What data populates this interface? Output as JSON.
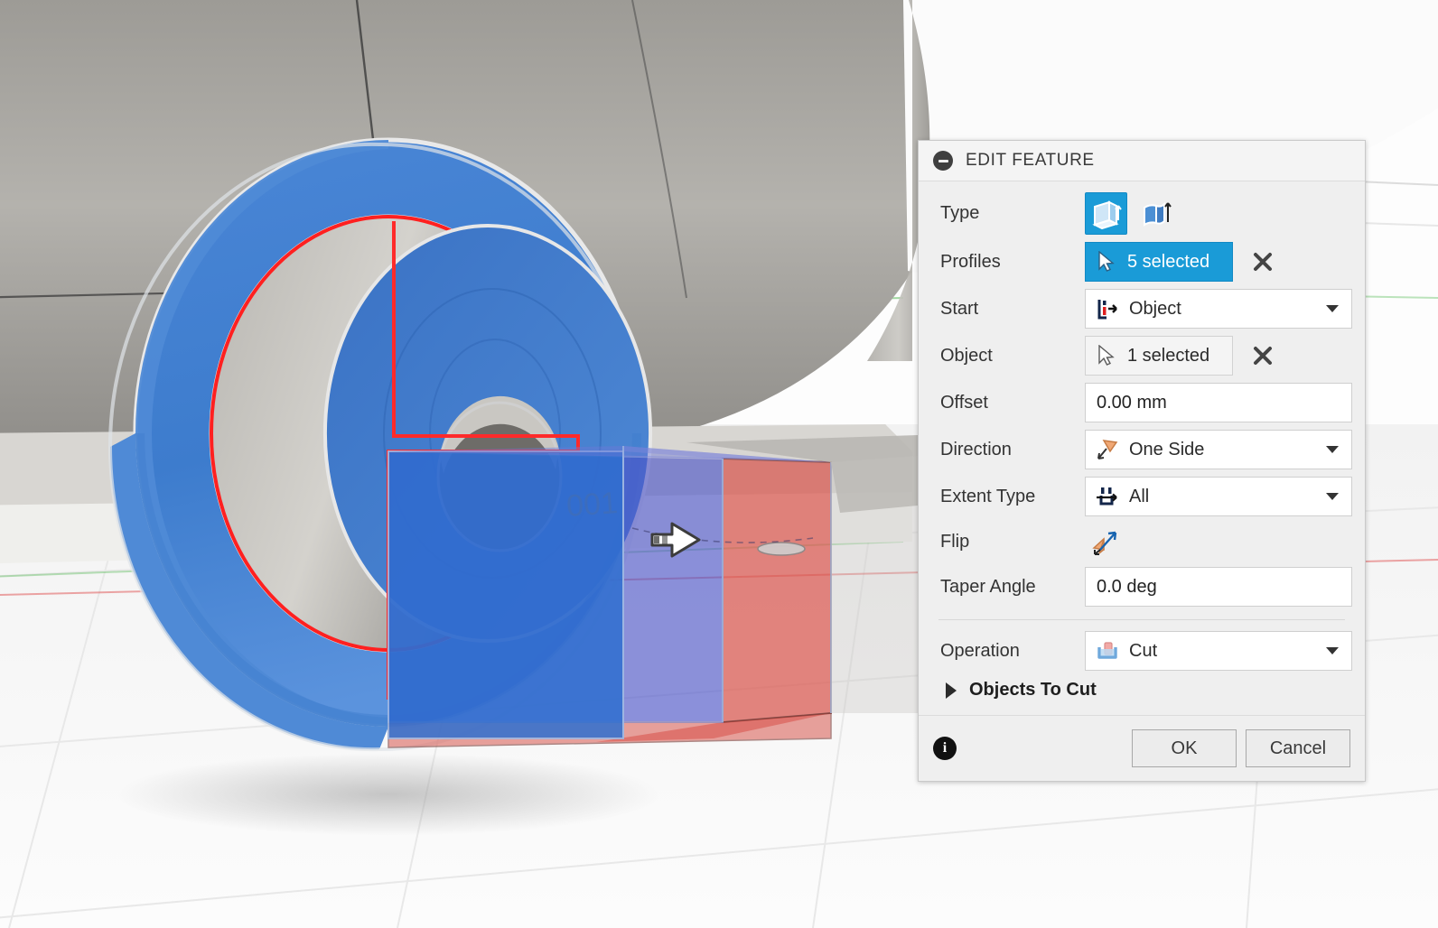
{
  "dialog": {
    "title": "EDIT FEATURE",
    "collapse_icon": "minus-circle-icon",
    "rows": {
      "type": {
        "label": "Type",
        "options": [
          "extrude-profile-icon",
          "extrude-surface-icon"
        ],
        "selected_index": 0
      },
      "profiles": {
        "label": "Profiles",
        "value": "5 selected",
        "selected": true,
        "clear_icon": "close-icon"
      },
      "start": {
        "label": "Start",
        "value": "Object",
        "icon": "start-object-icon"
      },
      "object": {
        "label": "Object",
        "value": "1 selected",
        "selected": false,
        "clear_icon": "close-icon"
      },
      "offset": {
        "label": "Offset",
        "value": "0.00 mm"
      },
      "direction": {
        "label": "Direction",
        "value": "One Side",
        "icon": "one-side-icon"
      },
      "extent_type": {
        "label": "Extent Type",
        "value": "All",
        "icon": "extent-all-icon"
      },
      "flip": {
        "label": "Flip",
        "icon": "flip-direction-icon"
      },
      "taper_angle": {
        "label": "Taper Angle",
        "value": "0.0 deg"
      },
      "operation": {
        "label": "Operation",
        "value": "Cut",
        "icon": "cut-operation-icon"
      }
    },
    "section": {
      "label": "Objects To Cut",
      "expanded": false,
      "toggle_icon": "triangle-right-icon"
    },
    "footer": {
      "info_icon": "info-icon",
      "ok_label": "OK",
      "cancel_label": "Cancel"
    }
  },
  "viewport": {
    "annotation_text": "001",
    "manipulator_icon": "arrow-drag-handle-icon",
    "colors": {
      "selected_face": "#3f7fd0",
      "highlight_edge": "#ff2a2a",
      "preview_cut": "#d9574f",
      "preview_body": "#4a52c8",
      "body_grey": "#a9a7a3",
      "ground": "#fafafa"
    }
  }
}
